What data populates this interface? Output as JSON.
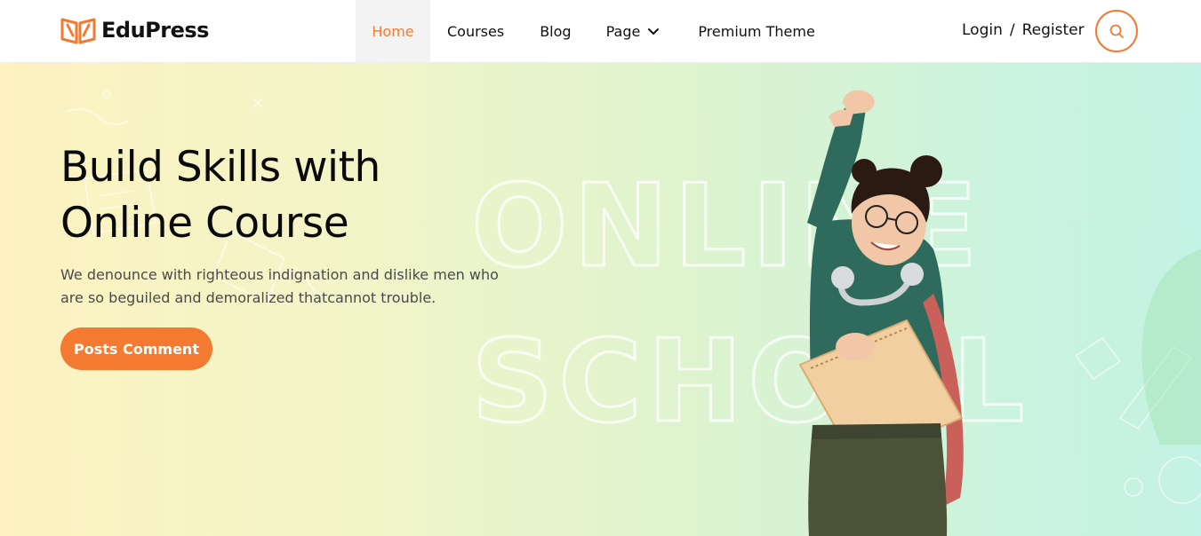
{
  "brand": {
    "name": "EduPress",
    "accent": "#f47a32",
    "logo_icon": "open-book-logo-icon"
  },
  "nav": {
    "items": [
      {
        "label": "Home",
        "active": true
      },
      {
        "label": "Courses",
        "active": false
      },
      {
        "label": "Blog",
        "active": false
      },
      {
        "label": "Page",
        "active": false,
        "has_dropdown": true
      },
      {
        "label": "Premium Theme",
        "active": false
      }
    ]
  },
  "auth": {
    "login": "Login",
    "separator": "/",
    "register": "Register"
  },
  "search": {
    "icon": "search-icon"
  },
  "hero": {
    "title_line1": "Build Skills with",
    "title_line2": "Online Course",
    "description": "We denounce with righteous indignation and dislike men who are so beguiled and demoralized thatcannot trouble.",
    "button_label": "Posts Comment",
    "watermark_line1": "ONLINE",
    "watermark_line2": "SCHOOL"
  }
}
